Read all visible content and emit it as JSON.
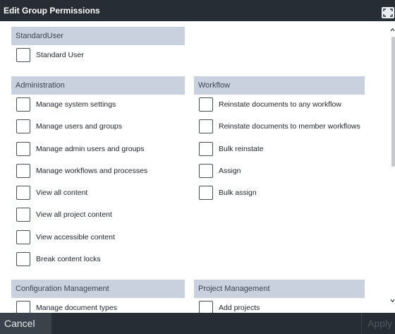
{
  "dialog": {
    "title": "Edit Group Permissions",
    "expand_icon": "expand-icon"
  },
  "sections": {
    "standard_user": {
      "header": "StandardUser",
      "items": [
        "Standard User"
      ]
    },
    "administration": {
      "header": "Administration",
      "items": [
        "Manage system settings",
        "Manage users and groups",
        "Manage admin users and groups",
        "Manage workflows and processes",
        "View all content",
        "View all project content",
        "View accessible content",
        "Break content locks"
      ]
    },
    "workflow": {
      "header": "Workflow",
      "items": [
        "Reinstate documents to any workflow",
        "Reinstate documents to member workflows",
        "Bulk reinstate",
        "Assign",
        "Bulk assign"
      ]
    },
    "configuration_management": {
      "header": "Configuration Management",
      "items": [
        "Manage document types"
      ]
    },
    "project_management": {
      "header": "Project Management",
      "items": [
        "Add projects"
      ]
    }
  },
  "footer": {
    "cancel_label": "Cancel",
    "apply_label": "Apply"
  },
  "colors": {
    "titlebar": "#262d35",
    "section_header": "#c9d1df",
    "scroll_thumb": "#c6c8cb"
  }
}
